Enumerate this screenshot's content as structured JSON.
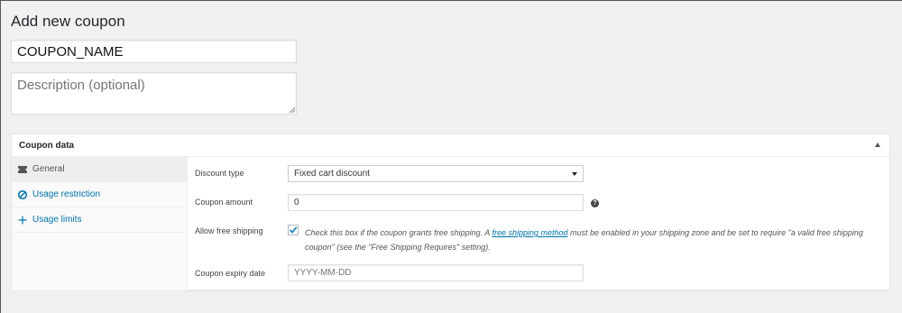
{
  "page": {
    "title": "Add new coupon",
    "coupon_code_value": "COUPON_NAME",
    "description_placeholder": "Description (optional)"
  },
  "coupon_data": {
    "title": "Coupon data",
    "tabs": [
      {
        "label": "General",
        "icon": "ticket-icon",
        "active": true
      },
      {
        "label": "Usage restriction",
        "icon": "ban-icon",
        "active": false
      },
      {
        "label": "Usage limits",
        "icon": "plus-icon",
        "active": false
      }
    ],
    "fields": {
      "discount_type_label": "Discount type",
      "discount_type_value": "Fixed cart discount",
      "coupon_amount_label": "Coupon amount",
      "coupon_amount_value": "0",
      "help_glyph": "?",
      "free_shipping_label": "Allow free shipping",
      "free_shipping_checked": true,
      "free_shipping_desc_pre": "Check this box if the coupon grants free shipping. A ",
      "free_shipping_desc_link": "free shipping method",
      "free_shipping_desc_post": " must be enabled in your shipping zone and be set to require \"a valid free shipping coupon\" (see the \"Free Shipping Requires\" setting).",
      "expiry_label": "Coupon expiry date",
      "expiry_placeholder": "YYYY-MM-DD"
    }
  },
  "colors": {
    "link": "#0073aa",
    "page_bg": "#f1f1f1",
    "checkmark": "#1e8cbe"
  }
}
